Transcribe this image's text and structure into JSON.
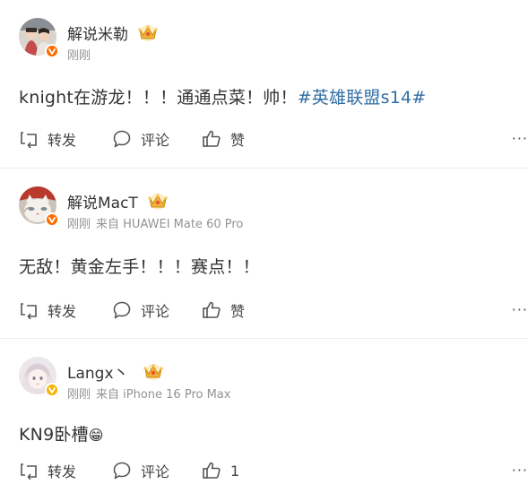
{
  "posts": [
    {
      "author": "解说米勒",
      "time": "刚刚",
      "source": "",
      "content_text": "knight在游龙！！！通通点菜！帅！",
      "topic": "#英雄联盟s14#",
      "badge_color": "#ff6a00",
      "actions": {
        "repost_label": "转发",
        "comment_label": "评论",
        "like_label": "赞"
      },
      "more_label": "···"
    },
    {
      "author": "解说MacT",
      "time": "刚刚",
      "source": "来自 HUAWEI Mate 60 Pro",
      "content_text": "无敌！黄金左手！！！赛点！！",
      "topic": "",
      "badge_color": "#ff6a00",
      "actions": {
        "repost_label": "转发",
        "comment_label": "评论",
        "like_label": "赞"
      },
      "more_label": "···"
    },
    {
      "author": "Langx丶",
      "time": "刚刚",
      "source": "来自 iPhone 16 Pro Max",
      "content_text": "KN9卧槽",
      "emoji": "😁",
      "topic": "",
      "badge_color": "#f5b400",
      "actions": {
        "repost_label": "转发",
        "comment_label": "评论",
        "like_label": "1"
      },
      "more_label": "···"
    }
  ],
  "icons": {
    "verified": "verified-badge-icon",
    "crown": "crown-icon",
    "repost": "repost-icon",
    "comment": "comment-icon",
    "like": "thumbs-up-icon",
    "more": "more-dots-icon"
  },
  "colors": {
    "topic_link": "#2f6ea5",
    "meta_gray": "#939393",
    "text": "#333333",
    "crown_gold": "#f0b43c"
  }
}
